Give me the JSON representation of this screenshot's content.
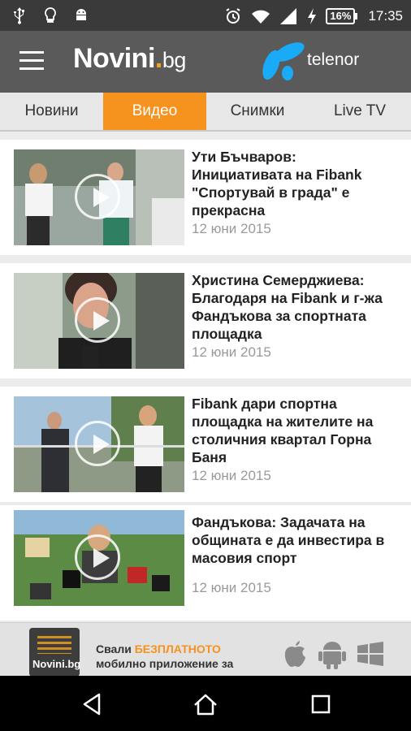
{
  "status_bar": {
    "battery": "16%",
    "time": "17:35",
    "icons": [
      "usb-icon",
      "lightbulb-icon",
      "android-icon",
      "alarm-icon",
      "wifi-icon",
      "signal-icon",
      "charging-icon"
    ]
  },
  "app_bar": {
    "logo_main": "Novini",
    "logo_dot": ".",
    "logo_tld": "bg",
    "sponsor": "telenor"
  },
  "tabs": [
    {
      "label": "Новини",
      "active": false
    },
    {
      "label": "Видео",
      "active": true
    },
    {
      "label": "Снимки",
      "active": false
    },
    {
      "label": "Live TV",
      "active": false
    }
  ],
  "articles": [
    {
      "title": "Ути Бъчваров: Инициативата на Fibank \"Спортувай в града\" е прекрасна",
      "date": "12 юни 2015"
    },
    {
      "title": "Христина Семерджиева: Благодаря на Fibank и г-жа Фандъкова за спортната площадка",
      "date": "12 юни 2015"
    },
    {
      "title": "Fibank дари спортна площадка на жителите на столичния квартал Горна Баня",
      "date": "12 юни 2015"
    },
    {
      "title": "Фандъкова: Задачата на общината е да инвестира в масовия спорт",
      "date": "12 юни 2015"
    }
  ],
  "banner": {
    "logo_text": "Novini.bg",
    "line1_prefix": "Свали ",
    "line1_highlight": "БЕЗПЛАТНОТО",
    "line2": "мобилно приложение за"
  },
  "colors": {
    "accent": "#f6921e",
    "app_bar": "#5a5a5a",
    "status_bar": "#3a3a3a",
    "telenor_blue": "#19aaf8"
  }
}
